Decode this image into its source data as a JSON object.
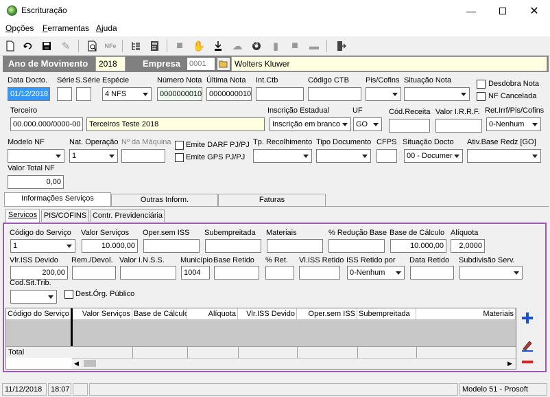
{
  "window": {
    "title": "Escrituração"
  },
  "menu": {
    "items": [
      "Opções",
      "Ferramentas",
      "Ajuda"
    ]
  },
  "header": {
    "ano_label": "Ano de Movimento",
    "ano_value": "2018",
    "empresa_label": "Empresa",
    "empresa_code": "0001",
    "empresa_name": "Wolters Kluwer"
  },
  "row1": {
    "data_docto_label": "Data Docto.",
    "data_docto_value": "01/12/2018",
    "serie_label": "Série",
    "sserie_label": "S.Série",
    "especie_label": "Espécie",
    "especie_value": "4 NFS",
    "numero_nota_label": "Número Nota",
    "numero_nota_value": "0000000010",
    "ultima_nota_label": "Última Nota",
    "ultima_nota_value": "0000000010",
    "int_ctb_label": "Int.Ctb",
    "codigo_ctb_label": "Código CTB",
    "pis_cofins_label": "Pis/Cofins",
    "situacao_nota_label": "Situação Nota",
    "desdobra_label": "Desdobra Nota",
    "nf_cancelada_label": "NF Cancelada"
  },
  "row2": {
    "terceiro_label": "Terceiro",
    "terceiro_cnpj": "00.000.000/0000-00",
    "terceiro_name": "Terceiros Teste 2018",
    "inscricao_label": "Inscrição Estadual",
    "inscricao_value": "Inscrição em branco",
    "uf_label": "UF",
    "uf_value": "GO",
    "cod_receita_label": "Cód.Receita",
    "valor_irrf_label": "Valor I.R.R.F.",
    "ret_irrf_label": "Ret.Irrf/Pis/Cofins",
    "ret_irrf_value": "0-Nenhum"
  },
  "row3": {
    "modelo_nf_label": "Modelo NF",
    "nat_operacao_label": "Nat. Operação",
    "nat_operacao_value": "1",
    "nro_maquina_label": "Nº da Máquina",
    "emite_darf_label": "Emite DARF PJ/PJ",
    "emite_gps_label": "Emite GPS PJ/PJ",
    "tp_recolhimento_label": "Tp. Recolhimento",
    "tipo_documento_label": "Tipo Documento",
    "cfps_label": "CFPS",
    "situacao_docto_label": "Situação Docto",
    "situacao_docto_value": "00 - Documer",
    "ativ_base_label": "Ativ.Base Redz [GO]"
  },
  "row4": {
    "valor_total_label": "Valor Total NF",
    "valor_total_value": "0,00"
  },
  "tabs": {
    "main": [
      "Informações Serviços",
      "Outras Inform.",
      "Faturas"
    ],
    "sub": [
      "Servicos",
      "PIS/COFINS",
      "Contr. Previdenciária"
    ]
  },
  "servicos": {
    "codigo_servico_label": "Código do Serviço",
    "codigo_servico_value": "1",
    "valor_servicos_label": "Valor Serviços",
    "valor_servicos_value": "10.000,00",
    "oper_sem_iss_label": "Oper.sem ISS",
    "subempreitada_label": "Subempreitada",
    "materiais_label": "Materiais",
    "reducao_base_label": "% Redução Base",
    "base_calculo_label": "Base de Cálculo",
    "base_calculo_value": "10.000,00",
    "aliquota_label": "Alíquota",
    "aliquota_value": "2,0000",
    "vlr_iss_devido_label": "Vlr.ISS Devido",
    "vlr_iss_devido_value": "200,00",
    "rem_devol_label": "Rem./Devol.",
    "valor_inss_label": "Valor I.N.S.S.",
    "municipio_label": "Município",
    "municipio_value": "1004",
    "base_retido_label": "Base Retido",
    "pct_ret_label": "% Ret.",
    "vl_iss_retido_label": "Vl.ISS Retido",
    "iss_retido_por_label": "ISS Retido por",
    "iss_retido_por_value": "0-Nenhum",
    "data_retido_label": "Data Retido",
    "subdivisao_label": "Subdivisão Serv.",
    "cod_sit_trib_label": "Cod.Sit.Trib.",
    "dest_org_label": "Dest.Órg. Público"
  },
  "grid": {
    "columns": [
      "Código do Serviço",
      "Valor Serviços",
      "Base de Cálculo",
      "Alíquota",
      "Vlr.ISS Devido",
      "Oper.sem ISS",
      "Subempreitada",
      "Materiais"
    ],
    "total_label": "Total"
  },
  "status": {
    "date": "11/12/2018",
    "time": "18:07",
    "model": "Modelo 51 - Prosoft"
  },
  "colors": {
    "panel_border": "#9b59b6",
    "header_band": "#808080",
    "field_yellow": "#ffffe1",
    "add_blue": "#1a4fd6",
    "remove_red": "#e02020"
  }
}
